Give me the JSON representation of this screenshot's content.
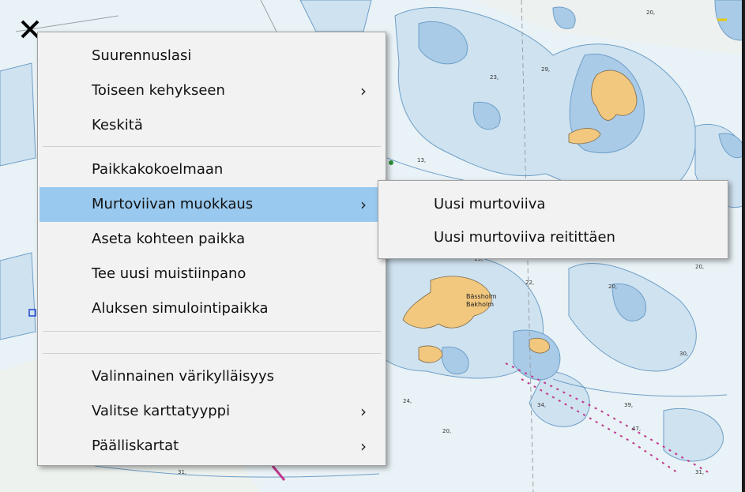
{
  "main_menu": {
    "items": [
      {
        "label": "Suurennuslasi",
        "arrow": ""
      },
      {
        "label": "Toiseen kehykseen",
        "arrow": "›"
      },
      {
        "label": "Keskitä",
        "arrow": ""
      },
      {
        "label": "Paikkakokoelmaan",
        "arrow": ""
      },
      {
        "label": "Murtoviivan muokkaus",
        "arrow": "›",
        "highlighted": true
      },
      {
        "label": "Aseta kohteen paikka",
        "arrow": ""
      },
      {
        "label": "Tee uusi muistiinpano",
        "arrow": ""
      },
      {
        "label": "Aluksen simulointipaikka",
        "arrow": ""
      },
      {
        "label": "Valinnainen värikylläisyys",
        "arrow": ""
      },
      {
        "label": "Valitse karttatyyppi",
        "arrow": "›"
      },
      {
        "label": "Päälliskartat",
        "arrow": "›"
      }
    ]
  },
  "sub_menu": {
    "items": [
      {
        "label": "Uusi murtoviiva"
      },
      {
        "label": "Uusi murtoviiva reitittäen"
      }
    ]
  },
  "map": {
    "island_labels": [
      "Bässholm",
      "Bakholm"
    ],
    "depth_labels": [
      "20,",
      "29,",
      "23,",
      "13,",
      "19,",
      "22,",
      "20,",
      "20,",
      "24,",
      "20,",
      "30,",
      "34,",
      "39,",
      "47,",
      "31,",
      "31,"
    ],
    "colors": {
      "water": "#e9f2f6",
      "shallow": "#cfe2f0",
      "shallow_deep": "#a9cbe7",
      "land": "#f2c77e",
      "contour": "#6e9fc7",
      "route": "#c0398d"
    }
  }
}
